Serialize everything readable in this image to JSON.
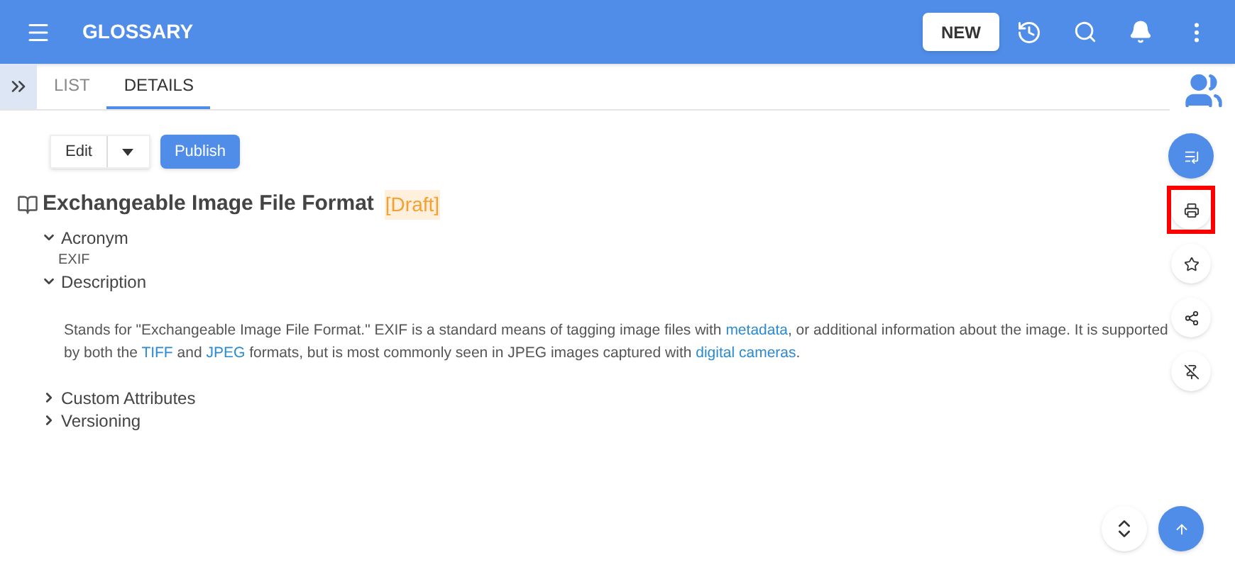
{
  "header": {
    "title": "GLOSSARY",
    "new_button": "NEW"
  },
  "tabs": [
    {
      "label": "LIST",
      "selected": false
    },
    {
      "label": "DETAILS",
      "selected": true
    }
  ],
  "toolbar": {
    "edit": "Edit",
    "publish": "Publish"
  },
  "entry": {
    "title": "Exchangeable Image File Format",
    "status": "[Draft]"
  },
  "sections": [
    {
      "label": "Acronym",
      "expanded": true,
      "kind": "value",
      "value": "EXIF"
    },
    {
      "label": "Description",
      "expanded": true,
      "kind": "paragraph",
      "segments": [
        {
          "text": "Stands for \"Exchangeable Image File Format.\" EXIF is a standard means of tagging image files with ",
          "kind": "text"
        },
        {
          "text": "metadata",
          "kind": "link"
        },
        {
          "text": ", or additional information about the image. It is supported by both the ",
          "kind": "text"
        },
        {
          "text": "TIFF",
          "kind": "link"
        },
        {
          "text": " and ",
          "kind": "text"
        },
        {
          "text": "JPEG",
          "kind": "link"
        },
        {
          "text": " formats, but is most commonly seen in JPEG images captured with ",
          "kind": "text"
        },
        {
          "text": "digital cameras",
          "kind": "link"
        },
        {
          "text": ".",
          "kind": "text"
        }
      ]
    },
    {
      "label": "Custom Attributes",
      "expanded": false
    },
    {
      "label": "Versioning",
      "expanded": false
    }
  ],
  "side_actions": [
    {
      "kind": "primary",
      "highlighted": false
    },
    {
      "kind": "print",
      "highlighted": true
    },
    {
      "kind": "star",
      "highlighted": false
    },
    {
      "kind": "share",
      "highlighted": false
    },
    {
      "kind": "unpin",
      "highlighted": false
    }
  ]
}
